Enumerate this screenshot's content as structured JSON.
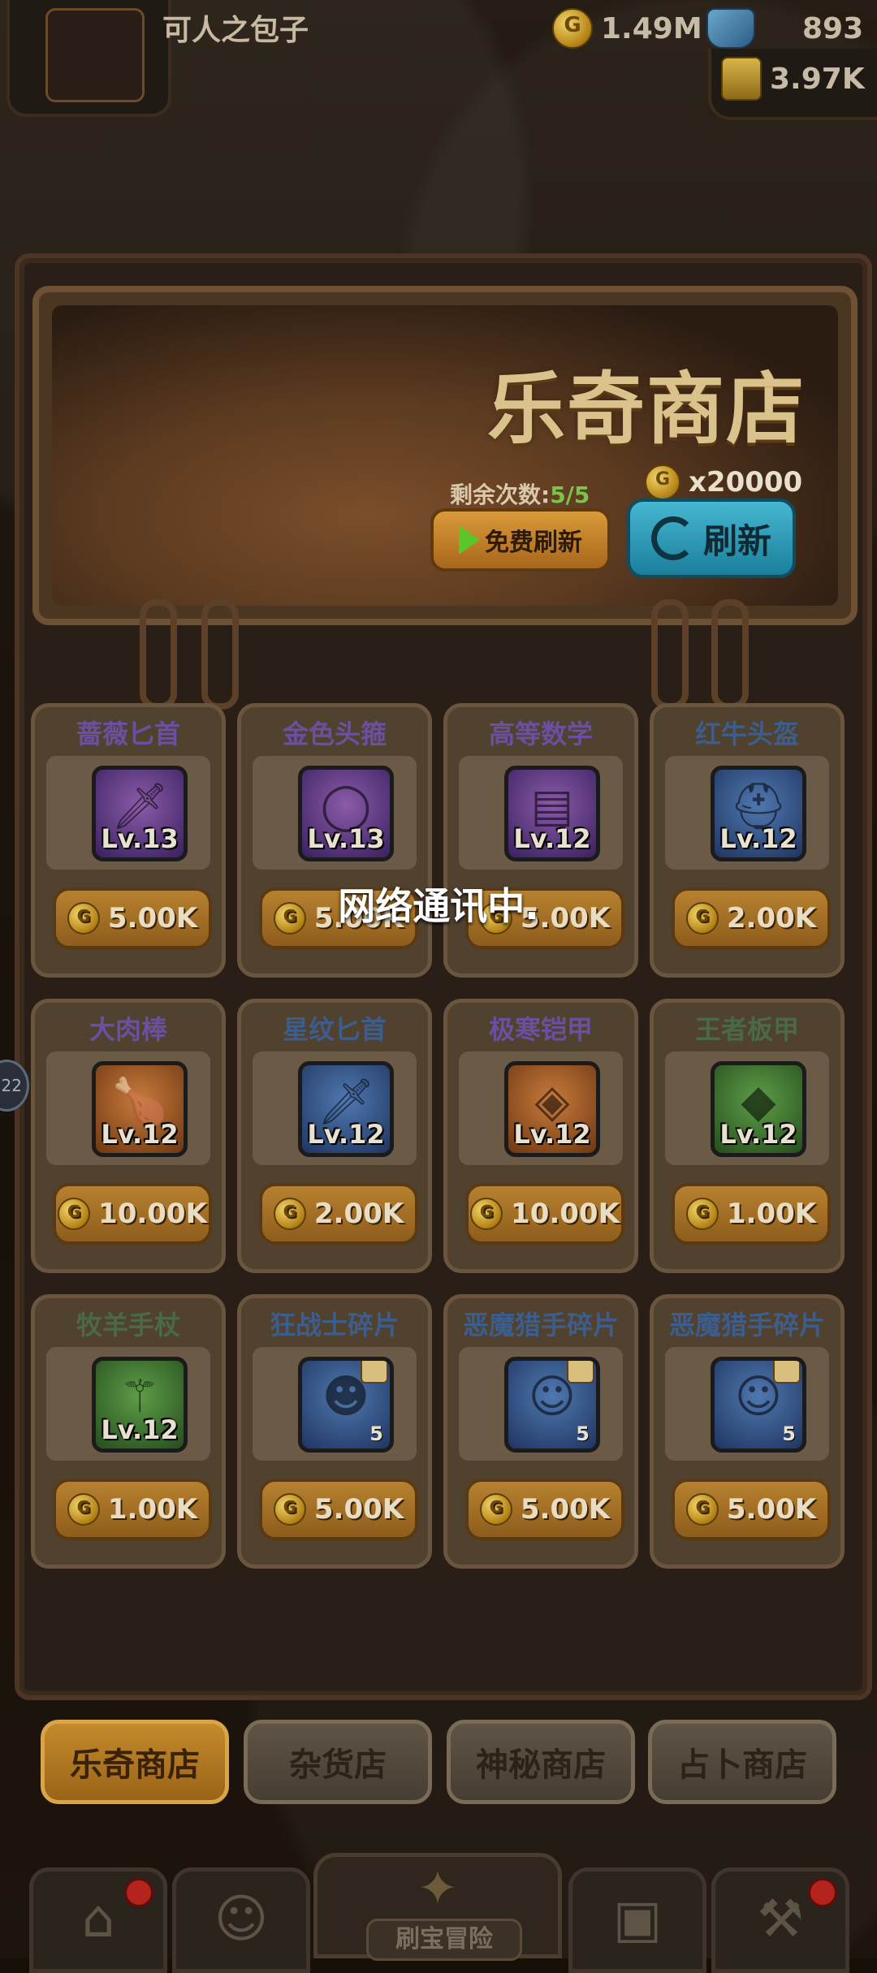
{
  "player": {
    "name": "可人之包子"
  },
  "resources": {
    "gold": "1.49M",
    "gems": "893",
    "scrolls": "3.97K"
  },
  "shop": {
    "title": "乐奇商店",
    "remaining_label": "剩余次数:",
    "remaining_value": "5/5",
    "refresh_cost": "x20000",
    "free_refresh_label": "免费刷新",
    "refresh_label": "刷新"
  },
  "items": [
    {
      "name": "蔷薇匕首",
      "level": "Lv.13",
      "price": "5.00K",
      "rarity": "purple",
      "icon": "dagger-icon"
    },
    {
      "name": "金色头箍",
      "level": "Lv.13",
      "price": "5.00K",
      "rarity": "purple",
      "icon": "circlet-icon"
    },
    {
      "name": "高等数学",
      "level": "Lv.12",
      "price": "5.00K",
      "rarity": "purple",
      "icon": "book-icon"
    },
    {
      "name": "红牛头盔",
      "level": "Lv.12",
      "price": "2.00K",
      "rarity": "blue",
      "icon": "helmet-icon"
    },
    {
      "name": "大肉棒",
      "level": "Lv.12",
      "price": "10.00K",
      "rarity": "orange",
      "icon": "meat-club-icon"
    },
    {
      "name": "星纹匕首",
      "level": "Lv.12",
      "price": "2.00K",
      "rarity": "blue",
      "icon": "dagger-icon"
    },
    {
      "name": "极寒铠甲",
      "level": "Lv.12",
      "price": "10.00K",
      "rarity": "orange",
      "icon": "armor-icon"
    },
    {
      "name": "王者板甲",
      "level": "Lv.12",
      "price": "1.00K",
      "rarity": "green",
      "icon": "plate-armor-icon"
    },
    {
      "name": "牧羊手杖",
      "level": "Lv.12",
      "price": "1.00K",
      "rarity": "green",
      "icon": "staff-icon"
    },
    {
      "name": "狂战士碎片",
      "count": "5",
      "price": "5.00K",
      "rarity": "blue",
      "icon": "berserker-shard-icon"
    },
    {
      "name": "恶魔猎手碎片",
      "count": "5",
      "price": "5.00K",
      "rarity": "blue",
      "icon": "demon-hunter-shard-icon"
    },
    {
      "name": "恶魔猎手碎片",
      "count": "5",
      "price": "5.00K",
      "rarity": "blue",
      "icon": "demon-hunter-shard-icon"
    }
  ],
  "toast": "网络通讯中.",
  "side_badge": "22",
  "tabs": [
    "乐奇商店",
    "杂货店",
    "神秘商店",
    "占卜商店"
  ],
  "bottom_nav": {
    "center_label": "刷宝冒险"
  }
}
